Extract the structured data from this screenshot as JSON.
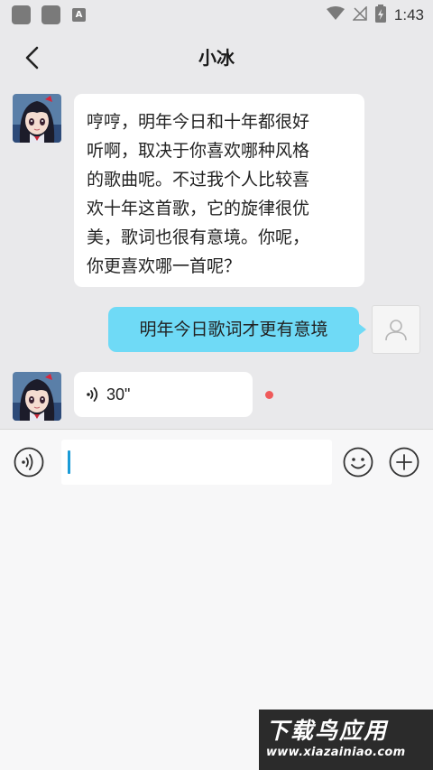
{
  "status_bar": {
    "time": "1:43",
    "icons": [
      "app-square-icon",
      "app-square-icon",
      "a-badge-icon",
      "wifi-icon",
      "no-signal-icon",
      "battery-charging-icon"
    ],
    "badge_letter": "A"
  },
  "header": {
    "title": "小冰",
    "back_icon": "chevron-left-icon"
  },
  "messages": [
    {
      "from": "bot",
      "avatar": "anime-girl-avatar",
      "lines": [
        "哼哼，明年今日和十年都很好",
        "听啊，取决于你喜欢哪种风格",
        "的歌曲呢。不过我个人比较喜",
        "欢十年这首歌，它的旋律很优",
        "美，歌词也很有意境。你呢，",
        "你更喜欢哪一首呢？"
      ]
    },
    {
      "from": "user",
      "avatar": "user-placeholder-avatar",
      "text": "明年今日歌词才更有意境"
    },
    {
      "from": "bot",
      "avatar": "anime-girl-avatar",
      "type": "voice",
      "duration": "30\"",
      "unread": true
    }
  ],
  "input_bar": {
    "voice_icon": "voice-mode-icon",
    "input_value": "",
    "emoji_icon": "emoji-icon",
    "plus_icon": "plus-icon"
  },
  "watermark": {
    "title": "下载鸟应用",
    "url": "www.xiazainiao.com"
  },
  "colors": {
    "chat_bg": "#e9e9eb",
    "outgoing_bubble": "#6fdaf6",
    "incoming_bubble": "#ffffff",
    "unread_dot": "#ef5a5a",
    "caret": "#1a9bd7"
  }
}
